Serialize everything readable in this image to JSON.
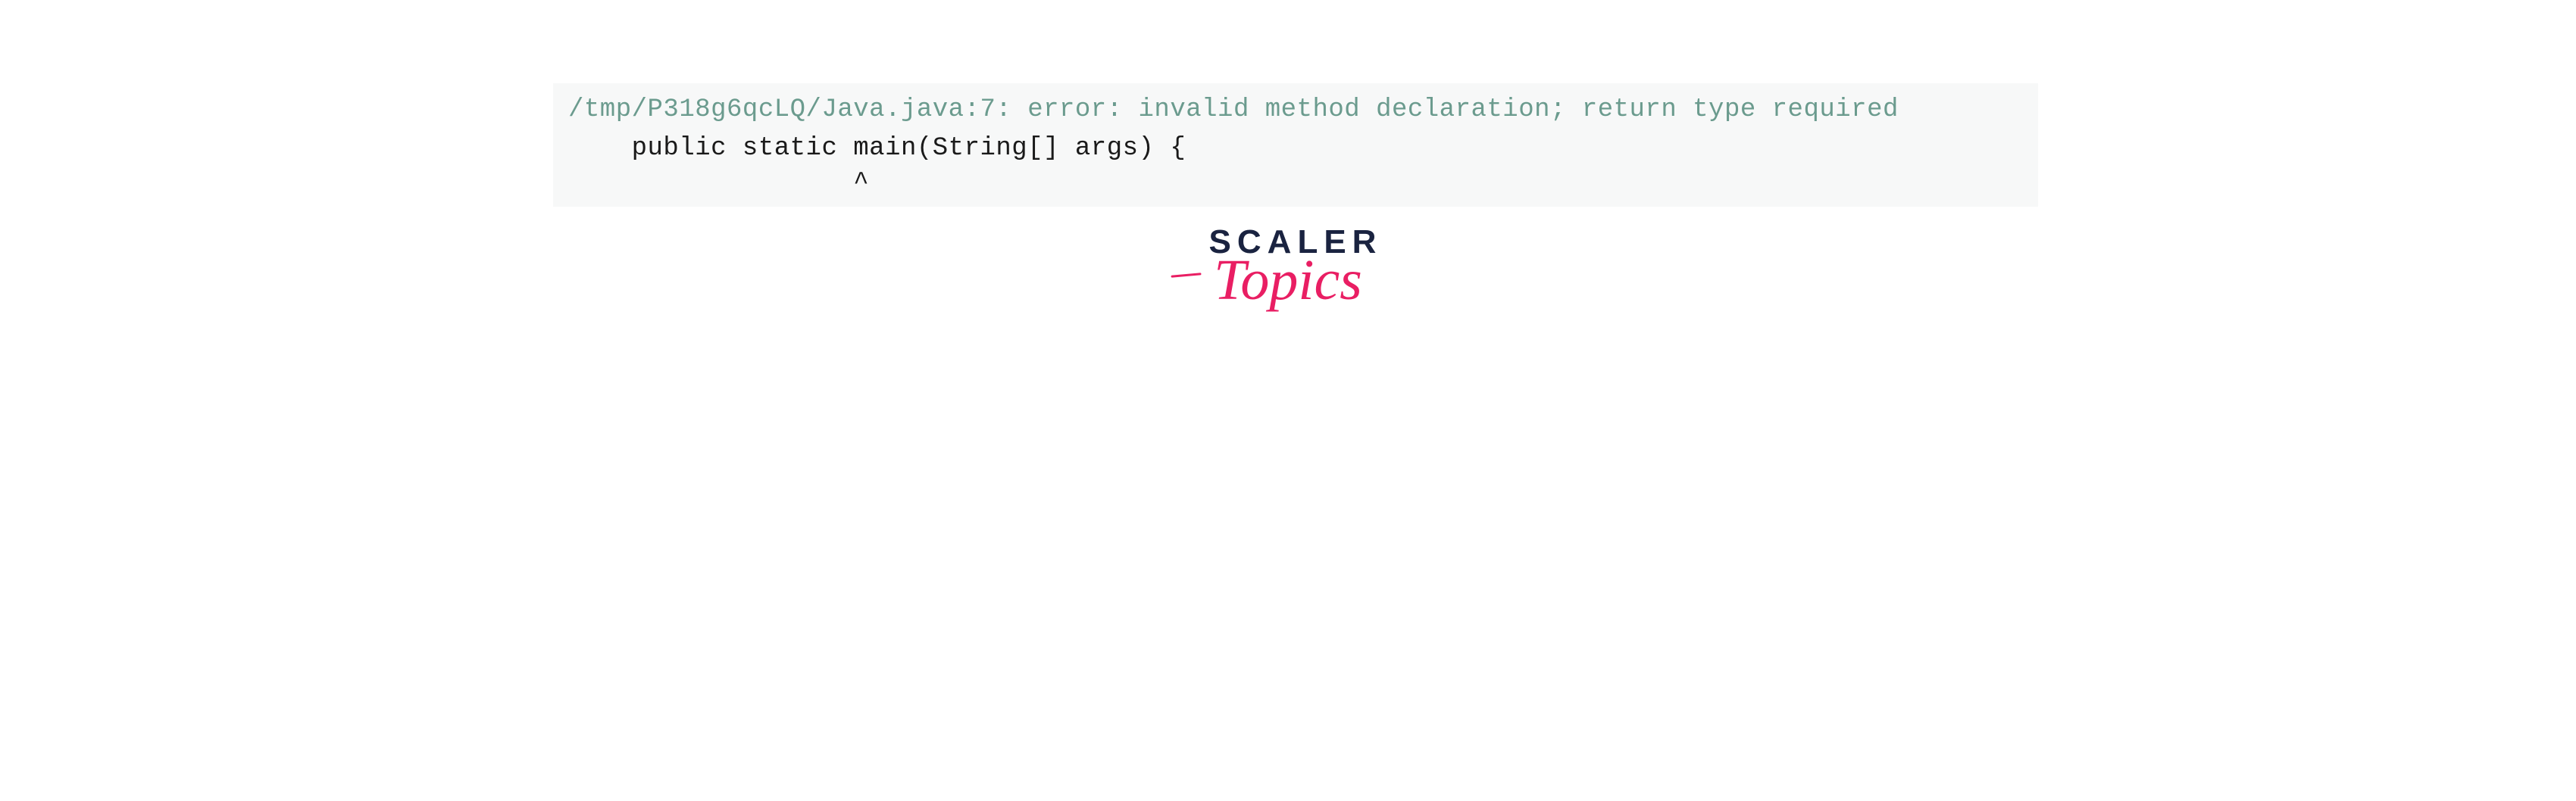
{
  "code_output": {
    "error_line": "/tmp/P318g6qcLQ/Java.java:7: error: invalid method declaration; return type required",
    "code_line": "    public static main(String[] args) {",
    "caret_line": "                  ^"
  },
  "logo": {
    "brand": "SCALER",
    "sub": "Topics"
  }
}
